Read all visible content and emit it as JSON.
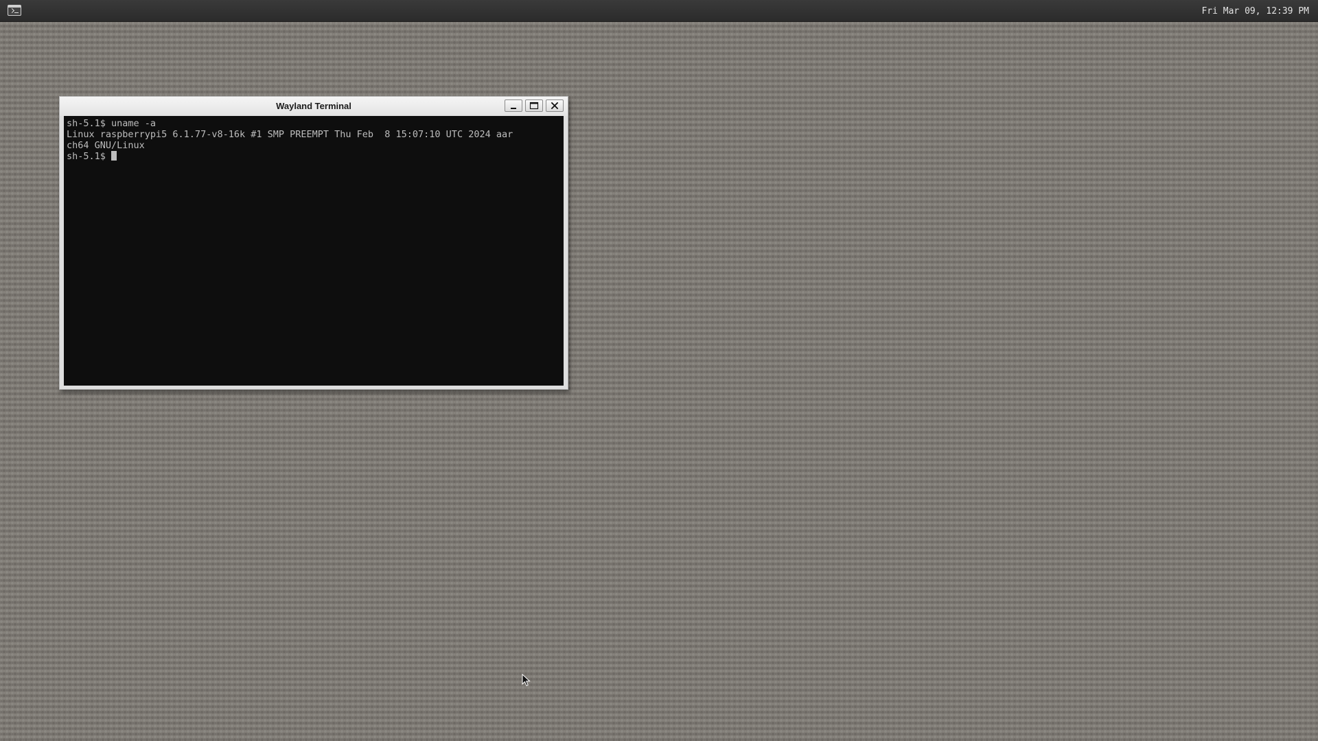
{
  "panel": {
    "launcher_icon": "terminal-icon",
    "clock": "Fri Mar 09, 12:39 PM"
  },
  "window": {
    "title": "Wayland Terminal",
    "buttons": {
      "minimize_icon": "minimize-icon",
      "maximize_icon": "maximize-icon",
      "close_icon": "close-icon"
    },
    "terminal": {
      "lines": [
        "sh-5.1$ uname -a",
        "Linux raspberrypi5 6.1.77-v8-16k #1 SMP PREEMPT Thu Feb  8 15:07:10 UTC 2024 aar",
        "ch64 GNU/Linux"
      ],
      "prompt": "sh-5.1$ "
    }
  },
  "colors": {
    "desktop": "#7e7a74",
    "panel": "#2f2f2f",
    "terminal_bg": "#0e0e0e",
    "terminal_fg": "#bdbdbd"
  }
}
